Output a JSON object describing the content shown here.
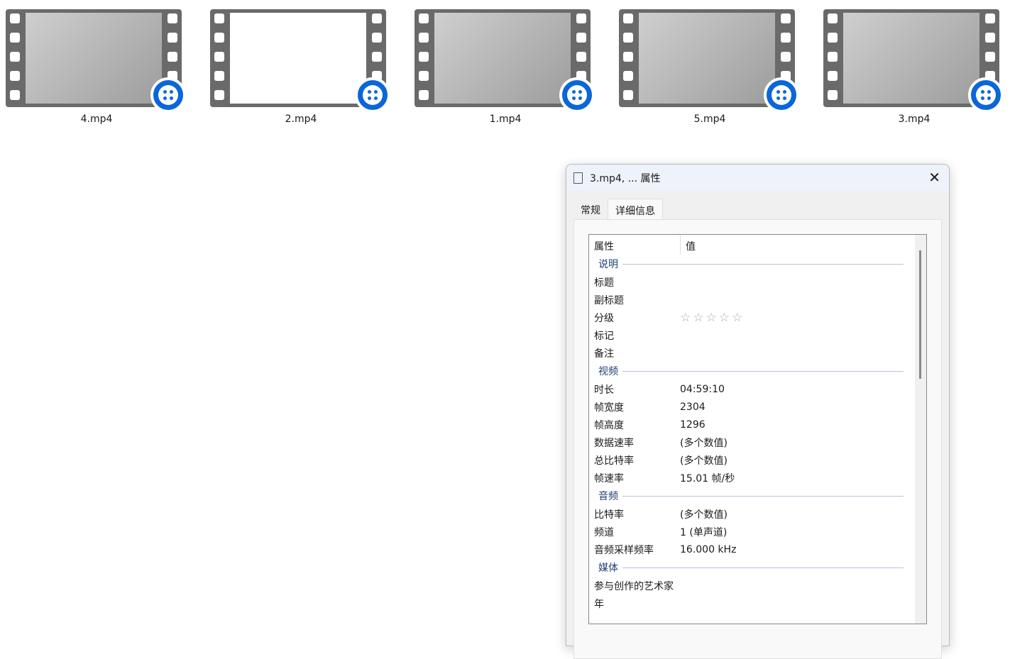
{
  "files": [
    {
      "name": "4.mp4"
    },
    {
      "name": "2.mp4"
    },
    {
      "name": "1.mp4"
    },
    {
      "name": "5.mp4"
    },
    {
      "name": "3.mp4"
    }
  ],
  "dialog": {
    "title": "3.mp4, ... 属性",
    "tabs": [
      "常规",
      "详细信息"
    ],
    "header": {
      "property": "属性",
      "value": "值"
    },
    "sections": [
      {
        "title": "说明",
        "rows": [
          {
            "k": "标题",
            "v": ""
          },
          {
            "k": "副标题",
            "v": ""
          },
          {
            "k": "分级",
            "v": "☆☆☆☆☆"
          },
          {
            "k": "标记",
            "v": ""
          },
          {
            "k": "备注",
            "v": ""
          }
        ]
      },
      {
        "title": "视频",
        "rows": [
          {
            "k": "时长",
            "v": "04:59:10"
          },
          {
            "k": "帧宽度",
            "v": "2304"
          },
          {
            "k": "帧高度",
            "v": "1296"
          },
          {
            "k": "数据速率",
            "v": "(多个数值)"
          },
          {
            "k": "总比特率",
            "v": "(多个数值)"
          },
          {
            "k": "帧速率",
            "v": "15.01 帧/秒"
          }
        ]
      },
      {
        "title": "音频",
        "rows": [
          {
            "k": "比特率",
            "v": "(多个数值)"
          },
          {
            "k": "频道",
            "v": "1 (单声道)"
          },
          {
            "k": "音频采样频率",
            "v": "16.000 kHz"
          }
        ]
      },
      {
        "title": "媒体",
        "rows": [
          {
            "k": "参与创作的艺术家",
            "v": ""
          },
          {
            "k": "年",
            "v": ""
          }
        ]
      }
    ]
  }
}
